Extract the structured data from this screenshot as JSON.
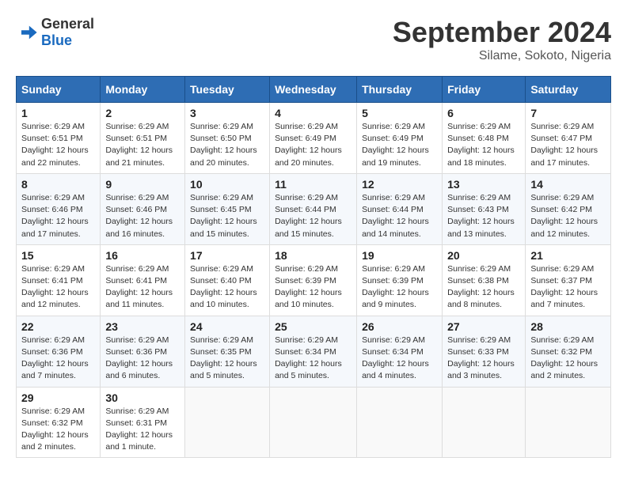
{
  "header": {
    "logo_general": "General",
    "logo_blue": "Blue",
    "month_title": "September 2024",
    "subtitle": "Silame, Sokoto, Nigeria"
  },
  "weekdays": [
    "Sunday",
    "Monday",
    "Tuesday",
    "Wednesday",
    "Thursday",
    "Friday",
    "Saturday"
  ],
  "weeks": [
    [
      {
        "day": "1",
        "sunrise": "6:29 AM",
        "sunset": "6:51 PM",
        "daylight": "12 hours and 22 minutes."
      },
      {
        "day": "2",
        "sunrise": "6:29 AM",
        "sunset": "6:51 PM",
        "daylight": "12 hours and 21 minutes."
      },
      {
        "day": "3",
        "sunrise": "6:29 AM",
        "sunset": "6:50 PM",
        "daylight": "12 hours and 20 minutes."
      },
      {
        "day": "4",
        "sunrise": "6:29 AM",
        "sunset": "6:49 PM",
        "daylight": "12 hours and 20 minutes."
      },
      {
        "day": "5",
        "sunrise": "6:29 AM",
        "sunset": "6:49 PM",
        "daylight": "12 hours and 19 minutes."
      },
      {
        "day": "6",
        "sunrise": "6:29 AM",
        "sunset": "6:48 PM",
        "daylight": "12 hours and 18 minutes."
      },
      {
        "day": "7",
        "sunrise": "6:29 AM",
        "sunset": "6:47 PM",
        "daylight": "12 hours and 17 minutes."
      }
    ],
    [
      {
        "day": "8",
        "sunrise": "6:29 AM",
        "sunset": "6:46 PM",
        "daylight": "12 hours and 17 minutes."
      },
      {
        "day": "9",
        "sunrise": "6:29 AM",
        "sunset": "6:46 PM",
        "daylight": "12 hours and 16 minutes."
      },
      {
        "day": "10",
        "sunrise": "6:29 AM",
        "sunset": "6:45 PM",
        "daylight": "12 hours and 15 minutes."
      },
      {
        "day": "11",
        "sunrise": "6:29 AM",
        "sunset": "6:44 PM",
        "daylight": "12 hours and 15 minutes."
      },
      {
        "day": "12",
        "sunrise": "6:29 AM",
        "sunset": "6:44 PM",
        "daylight": "12 hours and 14 minutes."
      },
      {
        "day": "13",
        "sunrise": "6:29 AM",
        "sunset": "6:43 PM",
        "daylight": "12 hours and 13 minutes."
      },
      {
        "day": "14",
        "sunrise": "6:29 AM",
        "sunset": "6:42 PM",
        "daylight": "12 hours and 12 minutes."
      }
    ],
    [
      {
        "day": "15",
        "sunrise": "6:29 AM",
        "sunset": "6:41 PM",
        "daylight": "12 hours and 12 minutes."
      },
      {
        "day": "16",
        "sunrise": "6:29 AM",
        "sunset": "6:41 PM",
        "daylight": "12 hours and 11 minutes."
      },
      {
        "day": "17",
        "sunrise": "6:29 AM",
        "sunset": "6:40 PM",
        "daylight": "12 hours and 10 minutes."
      },
      {
        "day": "18",
        "sunrise": "6:29 AM",
        "sunset": "6:39 PM",
        "daylight": "12 hours and 10 minutes."
      },
      {
        "day": "19",
        "sunrise": "6:29 AM",
        "sunset": "6:39 PM",
        "daylight": "12 hours and 9 minutes."
      },
      {
        "day": "20",
        "sunrise": "6:29 AM",
        "sunset": "6:38 PM",
        "daylight": "12 hours and 8 minutes."
      },
      {
        "day": "21",
        "sunrise": "6:29 AM",
        "sunset": "6:37 PM",
        "daylight": "12 hours and 7 minutes."
      }
    ],
    [
      {
        "day": "22",
        "sunrise": "6:29 AM",
        "sunset": "6:36 PM",
        "daylight": "12 hours and 7 minutes."
      },
      {
        "day": "23",
        "sunrise": "6:29 AM",
        "sunset": "6:36 PM",
        "daylight": "12 hours and 6 minutes."
      },
      {
        "day": "24",
        "sunrise": "6:29 AM",
        "sunset": "6:35 PM",
        "daylight": "12 hours and 5 minutes."
      },
      {
        "day": "25",
        "sunrise": "6:29 AM",
        "sunset": "6:34 PM",
        "daylight": "12 hours and 5 minutes."
      },
      {
        "day": "26",
        "sunrise": "6:29 AM",
        "sunset": "6:34 PM",
        "daylight": "12 hours and 4 minutes."
      },
      {
        "day": "27",
        "sunrise": "6:29 AM",
        "sunset": "6:33 PM",
        "daylight": "12 hours and 3 minutes."
      },
      {
        "day": "28",
        "sunrise": "6:29 AM",
        "sunset": "6:32 PM",
        "daylight": "12 hours and 2 minutes."
      }
    ],
    [
      {
        "day": "29",
        "sunrise": "6:29 AM",
        "sunset": "6:32 PM",
        "daylight": "12 hours and 2 minutes."
      },
      {
        "day": "30",
        "sunrise": "6:29 AM",
        "sunset": "6:31 PM",
        "daylight": "12 hours and 1 minute."
      },
      null,
      null,
      null,
      null,
      null
    ]
  ]
}
